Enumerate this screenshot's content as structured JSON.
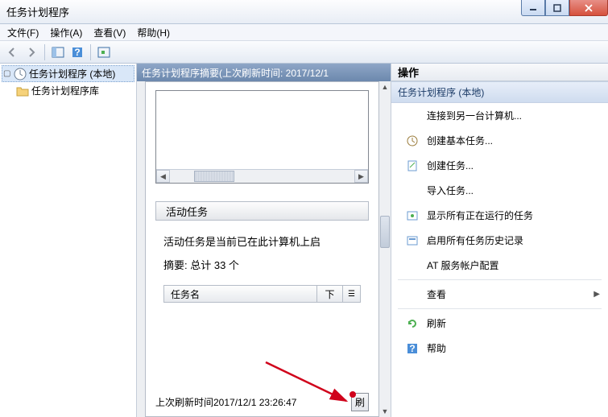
{
  "title": "任务计划程序",
  "menu": {
    "file": "文件(F)",
    "action": "操作(A)",
    "view": "查看(V)",
    "help": "帮助(H)"
  },
  "tree": {
    "root": "任务计划程序 (本地)",
    "lib": "任务计划程序库"
  },
  "center": {
    "header": "任务计划程序摘要(上次刷新时间: 2017/12/1",
    "active_section": "活动任务",
    "active_desc": "活动任务是当前已在此计算机上启",
    "summary": "摘要: 总计 33 个",
    "col_name": "任务名",
    "col_next": "下",
    "footer_time": "上次刷新时间2017/12/1 23:26:47",
    "refresh_btn": "刷"
  },
  "actions": {
    "header": "操作",
    "section": "任务计划程序 (本地)",
    "items": {
      "connect": "连接到另一台计算机...",
      "create_basic": "创建基本任务...",
      "create": "创建任务...",
      "import": "导入任务...",
      "show_running": "显示所有正在运行的任务",
      "enable_history": "启用所有任务历史记录",
      "at_account": "AT 服务帐户配置",
      "view": "查看",
      "refresh": "刷新",
      "help": "帮助"
    }
  }
}
